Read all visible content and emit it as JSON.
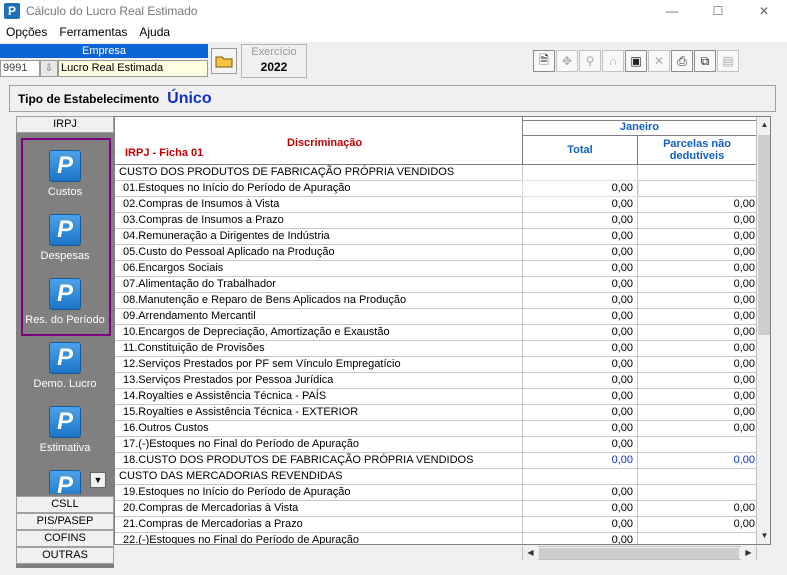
{
  "window": {
    "title": "Cálculo do Lucro Real Estimado",
    "minimize": "—",
    "maximize": "☐",
    "close": "✕"
  },
  "menu": [
    "Opções",
    "Ferramentas",
    "Ajuda"
  ],
  "empresa": {
    "label": "Empresa",
    "code": "9991",
    "name": "Lucro Real Estimada"
  },
  "exercicio": {
    "label": "Exercício",
    "value": "2022"
  },
  "toolbar_icons": [
    "document-icon",
    "move-icon",
    "search-user-icon",
    "magnet-icon",
    "save-icon",
    "delete-icon",
    "print-icon",
    "copy-icon",
    "calculator-icon"
  ],
  "tipo": {
    "label": "Tipo de Estabelecimento",
    "value": "Único"
  },
  "sidebar": {
    "header": "IRPJ",
    "items": [
      "Custos",
      "Despesas",
      "Res. do Período",
      "Demo. Lucro",
      "Estimativa"
    ],
    "bottom": [
      "CSLL",
      "PIS/PASEP",
      "COFINS",
      "OUTRAS"
    ]
  },
  "grid": {
    "disc_title": "Discriminação",
    "ficha": "IRPJ - Ficha 01",
    "month": "Janeiro",
    "col_total": "Total",
    "col_parc": "Parcelas não dedutíveis",
    "rows": [
      {
        "desc": "CUSTO DOS PRODUTOS DE FABRICAÇÃO PRÓPRIA VENDIDOS",
        "total": "",
        "parc": "",
        "type": "section"
      },
      {
        "desc": "01.Estoques no Início do Período de Apuração",
        "total": "0,00",
        "parc": "",
        "type": "item"
      },
      {
        "desc": "02.Compras de Insumos à Vista",
        "total": "0,00",
        "parc": "0,00",
        "type": "item"
      },
      {
        "desc": "03.Compras de Insumos a Prazo",
        "total": "0,00",
        "parc": "0,00",
        "type": "item"
      },
      {
        "desc": "04.Remuneração a Dirigentes de Indústria",
        "total": "0,00",
        "parc": "0,00",
        "type": "item"
      },
      {
        "desc": "05.Custo do Pessoal Aplicado na Produção",
        "total": "0,00",
        "parc": "0,00",
        "type": "item"
      },
      {
        "desc": "06.Encargos Sociais",
        "total": "0,00",
        "parc": "0,00",
        "type": "item"
      },
      {
        "desc": "07.Alimentação do Trabalhador",
        "total": "0,00",
        "parc": "0,00",
        "type": "item"
      },
      {
        "desc": "08.Manutenção e Reparo de Bens Aplicados na Produção",
        "total": "0,00",
        "parc": "0,00",
        "type": "item"
      },
      {
        "desc": "09.Arrendamento Mercantil",
        "total": "0,00",
        "parc": "0,00",
        "type": "item"
      },
      {
        "desc": "10.Encargos de Depreciação, Amortização e Exaustão",
        "total": "0,00",
        "parc": "0,00",
        "type": "item"
      },
      {
        "desc": "11.Constituição de Provisões",
        "total": "0,00",
        "parc": "0,00",
        "type": "item"
      },
      {
        "desc": "12.Serviços Prestados por PF sem Vínculo Empregatício",
        "total": "0,00",
        "parc": "0,00",
        "type": "item"
      },
      {
        "desc": "13.Serviços Prestados por Pessoa Jurídica",
        "total": "0,00",
        "parc": "0,00",
        "type": "item"
      },
      {
        "desc": "14.Royalties e Assistência Técnica - PAÍS",
        "total": "0,00",
        "parc": "0,00",
        "type": "item"
      },
      {
        "desc": "15.Royalties e Assistência Técnica - EXTERIOR",
        "total": "0,00",
        "parc": "0,00",
        "type": "item"
      },
      {
        "desc": "16.Outros Custos",
        "total": "0,00",
        "parc": "0,00",
        "type": "item"
      },
      {
        "desc": "17.(-)Estoques no Final do Período de Apuração",
        "total": "0,00",
        "parc": "",
        "type": "item"
      },
      {
        "desc": "18.CUSTO DOS PRODUTOS DE FABRICAÇÃO PRÓPRIA VENDIDOS",
        "total": "0,00",
        "parc": "0,00",
        "type": "total"
      },
      {
        "desc": "CUSTO DAS MERCADORIAS REVENDIDAS",
        "total": "",
        "parc": "",
        "type": "section"
      },
      {
        "desc": "19.Estoques no Início do Período de Apuração",
        "total": "0,00",
        "parc": "",
        "type": "item"
      },
      {
        "desc": "20.Compras de Mercadorias à Vista",
        "total": "0,00",
        "parc": "0,00",
        "type": "item"
      },
      {
        "desc": "21.Compras de Mercadorias a Prazo",
        "total": "0,00",
        "parc": "0,00",
        "type": "item"
      },
      {
        "desc": "22.(-)Estoques no Final do Período de Apuração",
        "total": "0,00",
        "parc": "",
        "type": "item"
      }
    ]
  }
}
